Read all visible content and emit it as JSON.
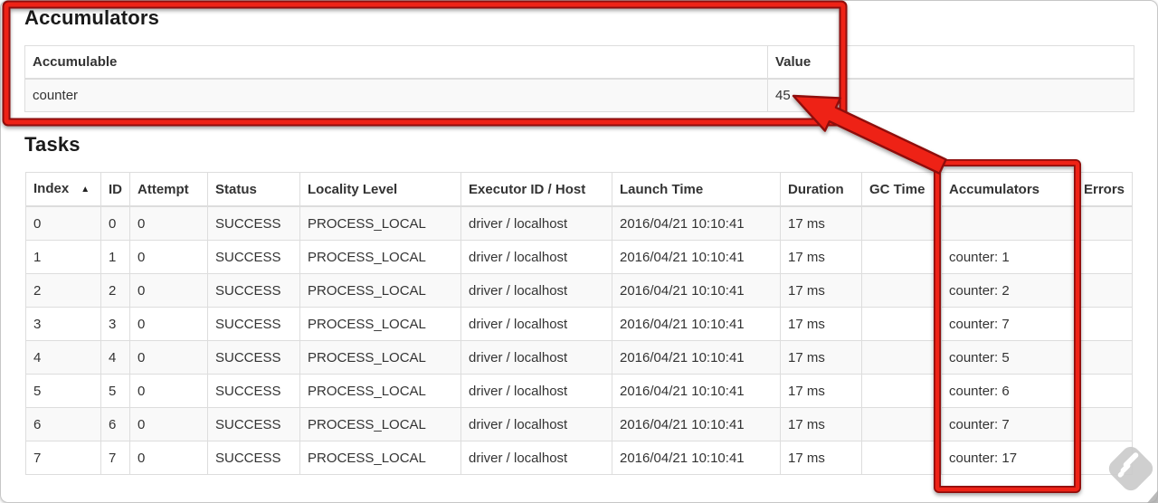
{
  "accumulators_section": {
    "title": "Accumulators",
    "table": {
      "headers": [
        "Accumulable",
        "Value"
      ],
      "rows": [
        [
          "counter",
          "45"
        ]
      ]
    }
  },
  "tasks_section": {
    "title": "Tasks",
    "table": {
      "headers": [
        "Index",
        "ID",
        "Attempt",
        "Status",
        "Locality Level",
        "Executor ID / Host",
        "Launch Time",
        "Duration",
        "GC Time",
        "Accumulators",
        "Errors"
      ],
      "sorted_column": "Index",
      "sort_icon": "▲",
      "rows": [
        [
          "0",
          "0",
          "0",
          "SUCCESS",
          "PROCESS_LOCAL",
          "driver / localhost",
          "2016/04/21 10:10:41",
          "17 ms",
          "",
          "",
          ""
        ],
        [
          "1",
          "1",
          "0",
          "SUCCESS",
          "PROCESS_LOCAL",
          "driver / localhost",
          "2016/04/21 10:10:41",
          "17 ms",
          "",
          "counter: 1",
          ""
        ],
        [
          "2",
          "2",
          "0",
          "SUCCESS",
          "PROCESS_LOCAL",
          "driver / localhost",
          "2016/04/21 10:10:41",
          "17 ms",
          "",
          "counter: 2",
          ""
        ],
        [
          "3",
          "3",
          "0",
          "SUCCESS",
          "PROCESS_LOCAL",
          "driver / localhost",
          "2016/04/21 10:10:41",
          "17 ms",
          "",
          "counter: 7",
          ""
        ],
        [
          "4",
          "4",
          "0",
          "SUCCESS",
          "PROCESS_LOCAL",
          "driver / localhost",
          "2016/04/21 10:10:41",
          "17 ms",
          "",
          "counter: 5",
          ""
        ],
        [
          "5",
          "5",
          "0",
          "SUCCESS",
          "PROCESS_LOCAL",
          "driver / localhost",
          "2016/04/21 10:10:41",
          "17 ms",
          "",
          "counter: 6",
          ""
        ],
        [
          "6",
          "6",
          "0",
          "SUCCESS",
          "PROCESS_LOCAL",
          "driver / localhost",
          "2016/04/21 10:10:41",
          "17 ms",
          "",
          "counter: 7",
          ""
        ],
        [
          "7",
          "7",
          "0",
          "SUCCESS",
          "PROCESS_LOCAL",
          "driver / localhost",
          "2016/04/21 10:10:41",
          "17 ms",
          "",
          "counter: 17",
          ""
        ]
      ]
    }
  },
  "annotations": {
    "highlight_color": "#ee2014",
    "highlight_edge_color": "#8e0f07"
  },
  "watermark_color": "#cbcbcb"
}
